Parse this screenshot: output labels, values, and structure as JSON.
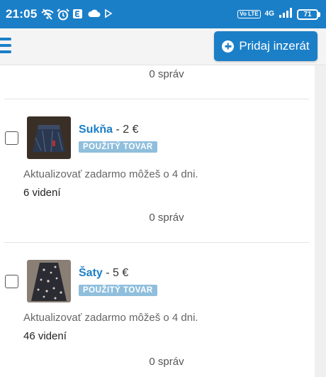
{
  "status_bar": {
    "time": "21:05",
    "left_icons": [
      "wifi-off-icon",
      "alarm-icon",
      "notification-e-icon",
      "cloud-icon",
      "play-icon"
    ],
    "volte": "Vo LTE",
    "network": "4G",
    "battery": "71"
  },
  "header": {
    "menu_icon": "hamburger-icon",
    "add_button_label": "Pridaj inzerát",
    "add_button_icon": "plus-circle-icon"
  },
  "listings": {
    "top_messages": "0 správ",
    "items": [
      {
        "title": "Sukňa",
        "price": " - 2 €",
        "badge": "POUŽITÝ TOVAR",
        "refresh_note": "Aktualizovať zadarmo môžeš o 4 dni.",
        "views": "6 videní",
        "messages": "0 správ"
      },
      {
        "title": "Šaty",
        "price": " - 5 €",
        "badge": "POUŽITÝ TOVAR",
        "refresh_note": "Aktualizovať zadarmo môžeš o 4 dni.",
        "views": "46 videní",
        "messages": "0 správ"
      }
    ]
  },
  "colors": {
    "primary": "#1b7fc8",
    "badge": "#8fbfdc",
    "divider": "#e3e3e3"
  }
}
